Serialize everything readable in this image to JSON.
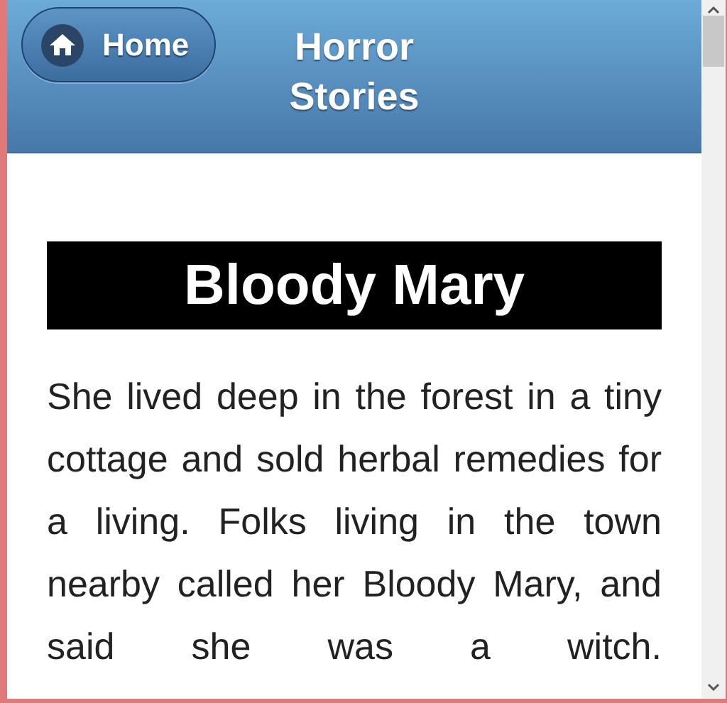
{
  "header": {
    "home_button": {
      "label": "Home"
    },
    "title": "Horror Stories"
  },
  "story": {
    "title": "Bloody Mary",
    "text": "She lived deep in the forest in a tiny cottage and sold herbal remedies for a living. Folks living in the town nearby called her Bloody Mary, and said she was a witch."
  }
}
